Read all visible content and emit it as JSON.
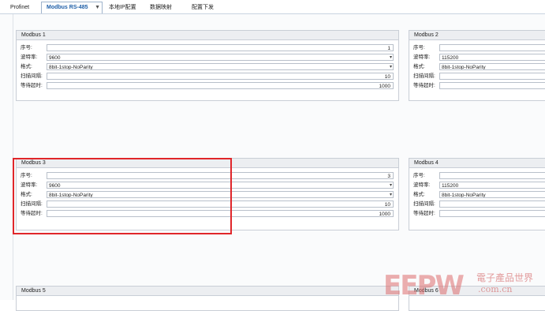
{
  "tabs": [
    {
      "label": "Profinet",
      "active": false
    },
    {
      "label": "Modbus RS-485",
      "active": true,
      "dropdown": "▼"
    },
    {
      "label": "本地IP配置",
      "active": false
    },
    {
      "label": "数据映射",
      "active": false
    },
    {
      "label": "配置下发",
      "active": false
    }
  ],
  "labels": {
    "seq": "序号:",
    "baud": "波特率:",
    "format": "格式:",
    "scan": "扫描间隔:",
    "timeout": "等待超时:"
  },
  "panels": [
    {
      "title": "Modbus 1",
      "seq": "1",
      "baud": "9600",
      "format": "8bit-1stop-NoParity",
      "scan": "10",
      "timeout": "1000"
    },
    {
      "title": "Modbus 2",
      "seq": "",
      "baud": "115200",
      "format": "8bit-1stop-NoParity",
      "scan": "",
      "timeout": ""
    },
    {
      "title": "Modbus 3",
      "seq": "3",
      "baud": "9600",
      "format": "8bit-1stop-NoParity",
      "scan": "10",
      "timeout": "1000"
    },
    {
      "title": "Modbus 4",
      "seq": "",
      "baud": "115200",
      "format": "8bit-1stop-NoParity",
      "scan": "",
      "timeout": ""
    },
    {
      "title": "Modbus 5"
    },
    {
      "title": "Modbus 6"
    }
  ],
  "watermark": {
    "logo": "EEPW",
    "cn": "電子產品世界",
    "url": ".com.cn"
  },
  "colors": {
    "highlight": "#e0262a",
    "active_tab": "#1f5fa8"
  }
}
